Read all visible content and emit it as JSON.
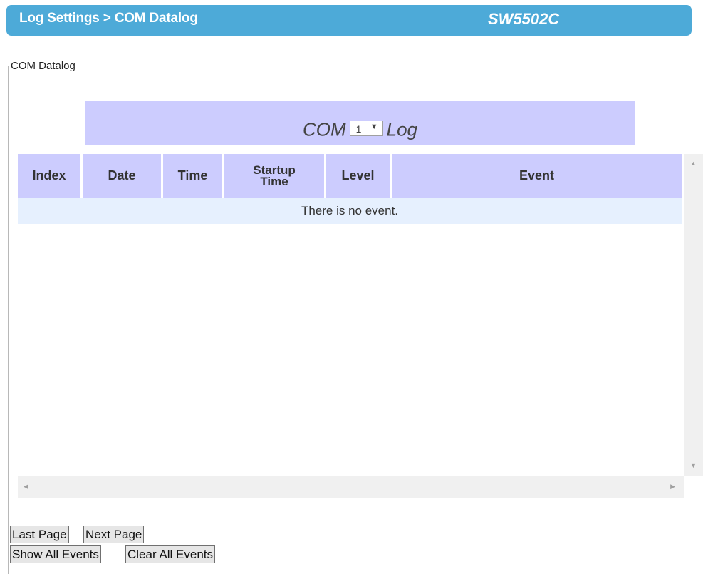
{
  "header": {
    "title": "Log Settings > COM Datalog",
    "model": "SW5502C",
    "bg_color": "#4daad8"
  },
  "section": {
    "legend": "COM Datalog"
  },
  "log_title": {
    "prefix": "COM",
    "port_selected": "1",
    "dropdown_arrow": "▼",
    "suffix": "Log",
    "bg_color": "#ccccfe"
  },
  "table": {
    "columns": [
      {
        "label": "Index"
      },
      {
        "label": "Date"
      },
      {
        "label": "Time"
      },
      {
        "label": "Startup Time"
      },
      {
        "label": "Level"
      },
      {
        "label": "Event"
      }
    ],
    "empty_message": "There is no event.",
    "header_color": "#ccccfe",
    "row_color": "#e6f0fe"
  },
  "scrollbars": {
    "up_icon": "▲",
    "down_icon": "▼",
    "left_icon": "◀",
    "right_icon": "▶"
  },
  "buttons": {
    "last_page": "Last Page",
    "next_page": "Next Page",
    "show_all": "Show All Events",
    "clear_all": "Clear All Events"
  }
}
